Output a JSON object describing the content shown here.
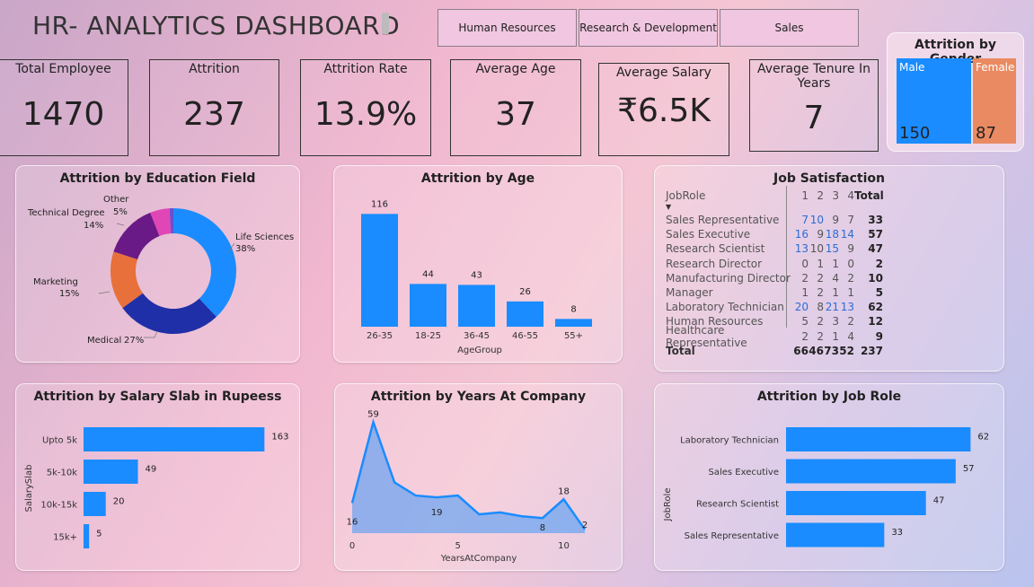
{
  "header": {
    "title": "HR- ANALYTICS DASHBOARD",
    "slicers": [
      "Human Resources",
      "Research & Development",
      "Sales"
    ]
  },
  "kpis": {
    "total_employee": {
      "label": "Total Employee",
      "value": "1470"
    },
    "attrition": {
      "label": "Attrition",
      "value": "237"
    },
    "attrition_rate": {
      "label": "Attrition Rate",
      "value": "13.9%"
    },
    "average_age": {
      "label": "Average Age",
      "value": "37"
    },
    "average_salary": {
      "label": "Average Salary",
      "value": "₹6.5K"
    },
    "average_tenure": {
      "label": "Average Tenure In Years",
      "value": "7"
    }
  },
  "gender": {
    "title": "Attrition by Gender",
    "male_label": "Male",
    "male_value": "150",
    "female_label": "Female",
    "female_value": "87"
  },
  "education": {
    "title": "Attrition by Education Field",
    "slices": [
      {
        "name": "Life Sciences",
        "pct": "38%",
        "value": 38,
        "color": "#1a8cff"
      },
      {
        "name": "Medical",
        "pct": "27%",
        "value": 27,
        "color": "#1f2fa8"
      },
      {
        "name": "Marketing",
        "pct": "15%",
        "value": 15,
        "color": "#e8703a"
      },
      {
        "name": "Technical Degree",
        "pct": "14%",
        "value": 14,
        "color": "#6a1a86"
      },
      {
        "name": "Other",
        "pct": "5%",
        "value": 5,
        "color": "#e046b6"
      },
      {
        "name": "",
        "pct": "",
        "value": 1,
        "color": "#6b4fd0"
      }
    ]
  },
  "age": {
    "title": "Attrition by Age",
    "xlabel": "AgeGroup"
  },
  "job_satisfaction": {
    "title": "Job Satisfaction",
    "col_header": "JobRole",
    "levels": [
      "1",
      "2",
      "3",
      "4"
    ],
    "total_label": "Total",
    "rows": [
      {
        "role": "Sales Representative",
        "v": [
          "7",
          "10",
          "9",
          "7"
        ],
        "total": "33",
        "blue": [
          true,
          true,
          false,
          false
        ]
      },
      {
        "role": "Sales Executive",
        "v": [
          "16",
          "9",
          "18",
          "14"
        ],
        "total": "57",
        "blue": [
          true,
          false,
          true,
          true
        ]
      },
      {
        "role": "Research Scientist",
        "v": [
          "13",
          "10",
          "15",
          "9"
        ],
        "total": "47",
        "blue": [
          true,
          false,
          true,
          false
        ]
      },
      {
        "role": "Research Director",
        "v": [
          "0",
          "1",
          "1",
          "0"
        ],
        "total": "2",
        "blue": [
          false,
          false,
          false,
          false
        ]
      },
      {
        "role": "Manufacturing Director",
        "v": [
          "2",
          "2",
          "4",
          "2"
        ],
        "total": "10",
        "blue": [
          false,
          false,
          false,
          false
        ]
      },
      {
        "role": "Manager",
        "v": [
          "1",
          "2",
          "1",
          "1"
        ],
        "total": "5",
        "blue": [
          false,
          false,
          false,
          false
        ]
      },
      {
        "role": "Laboratory Technician",
        "v": [
          "20",
          "8",
          "21",
          "13"
        ],
        "total": "62",
        "blue": [
          true,
          false,
          true,
          true
        ]
      },
      {
        "role": "Human Resources",
        "v": [
          "5",
          "2",
          "3",
          "2"
        ],
        "total": "12",
        "blue": [
          false,
          false,
          false,
          false
        ]
      },
      {
        "role": "Healthcare Representative",
        "v": [
          "2",
          "2",
          "1",
          "4"
        ],
        "total": "9",
        "blue": [
          false,
          false,
          false,
          false
        ]
      }
    ],
    "totals_row": {
      "role": "Total",
      "v": [
        "66",
        "46",
        "73",
        "52"
      ],
      "total": "237"
    }
  },
  "salary": {
    "title": "Attrition by Salary Slab in Rupeess",
    "ylabel": "SalarySlab"
  },
  "years": {
    "title": "Attrition by Years At Company",
    "xlabel": "YearsAtCompany"
  },
  "jobrole": {
    "title": "Attrition by Job Role",
    "ylabel": "JobRole"
  },
  "chart_data": [
    {
      "type": "bar",
      "title": "Attrition by Age",
      "categories": [
        "26-35",
        "18-25",
        "36-45",
        "46-55",
        "55+"
      ],
      "values": [
        116,
        44,
        43,
        26,
        8
      ],
      "xlabel": "AgeGroup",
      "ylabel": "",
      "ylim": [
        0,
        120
      ],
      "color": "#1a8cff"
    },
    {
      "type": "bar",
      "title": "Attrition by Salary Slab in Rupeess",
      "orientation": "horizontal",
      "categories": [
        "Upto 5k",
        "5k-10k",
        "10k-15k",
        "15k+"
      ],
      "values": [
        163,
        49,
        20,
        5
      ],
      "xlabel": "",
      "ylabel": "SalarySlab",
      "xlim": [
        0,
        170
      ],
      "color": "#1a8cff"
    },
    {
      "type": "area",
      "title": "Attrition by Years At Company",
      "x": [
        0,
        1,
        2,
        3,
        4,
        5,
        6,
        7,
        8,
        9,
        10,
        11
      ],
      "values": [
        16,
        59,
        27,
        20,
        19,
        20,
        10,
        11,
        9,
        8,
        18,
        2
      ],
      "labels": {
        "0": "16",
        "1": "59",
        "4": "19",
        "9": "8",
        "10": "18",
        "11": "2"
      },
      "xticks": [
        "0",
        "5",
        "10"
      ],
      "xlabel": "YearsAtCompany",
      "ylim": [
        0,
        62
      ],
      "color": "#1a8cff"
    },
    {
      "type": "bar",
      "title": "Attrition by Job Role",
      "orientation": "horizontal",
      "categories": [
        "Laboratory Technician",
        "Sales Executive",
        "Research Scientist",
        "Sales Representative"
      ],
      "values": [
        62,
        57,
        47,
        33
      ],
      "xlabel": "",
      "ylabel": "JobRole",
      "xlim": [
        0,
        64
      ],
      "color": "#1a8cff"
    },
    {
      "type": "pie",
      "title": "Attrition by Education Field",
      "categories": [
        "Life Sciences",
        "Medical",
        "Marketing",
        "Technical Degree",
        "Other"
      ],
      "values": [
        38,
        27,
        15,
        14,
        5
      ]
    }
  ]
}
